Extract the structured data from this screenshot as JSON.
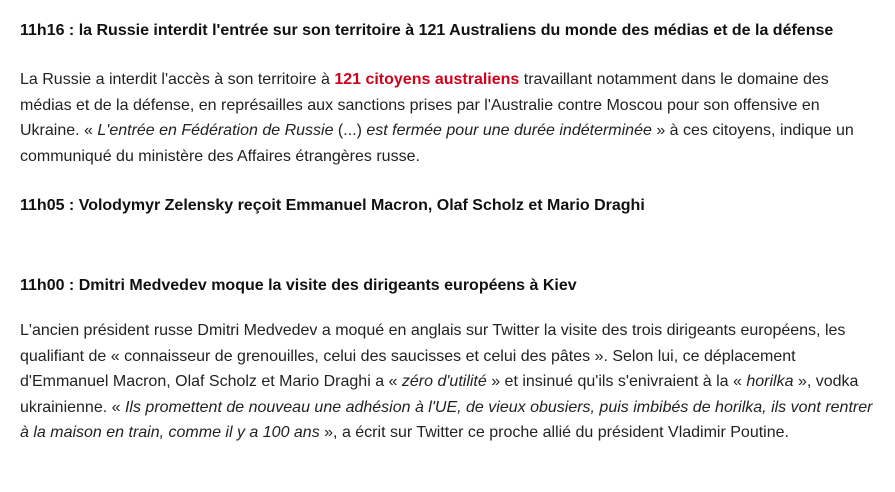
{
  "entries": [
    {
      "time": "11h16",
      "headline": "la Russie interdit l'entrée sur son territoire à 121 Australiens du monde des médias et de la défense",
      "body": {
        "p1": "La Russie a interdit l'accès à son territoire à ",
        "highlight": "121 citoyens australiens",
        "p2": " travaillant notamment dans le domaine des médias et de la défense, en représailles aux sanctions prises par l'Australie contre Moscou pour son offensive en Ukraine. « ",
        "quote1": "L'entrée en Fédération de Russie",
        "p3": " (...) ",
        "quote2": "est fermée pour une durée indéterminée",
        "p4": " » à ces citoyens, indique un communiqué du ministère des Affaires étrangères russe."
      }
    },
    {
      "time": "11h05",
      "headline": "Volodymyr Zelensky reçoit Emmanuel Macron, Olaf Scholz et Mario Draghi"
    },
    {
      "time": "11h00",
      "headline": "Dmitri Medvedev moque la visite des dirigeants européens à Kiev",
      "body": {
        "p1": "L'ancien président russe Dmitri Medvedev a moqué en anglais sur Twitter la visite des trois dirigeants européens, les qualifiant de « connaisseur de grenouilles, celui des saucisses et celui des pâtes ». Selon lui, ce déplacement d'Emmanuel Macron, Olaf Scholz et Mario Draghi a « ",
        "quote1": "zéro d'utilité",
        "p2": " » et insinué qu'ils s'enivraient à la « ",
        "quote2": "horilka",
        "p3": " », vodka ukrainienne. « ",
        "quote3": "Ils promettent de nouveau une adhésion à l'UE, de vieux obusiers, puis imbibés de horilka, ils vont rentrer à la maison en train, comme il y a 100 ans",
        "p4": " », a écrit sur Twitter ce proche allié du président Vladimir Poutine."
      }
    }
  ],
  "separator": " : ",
  "colors": {
    "highlight": "#d0021b",
    "text": "#222222"
  }
}
